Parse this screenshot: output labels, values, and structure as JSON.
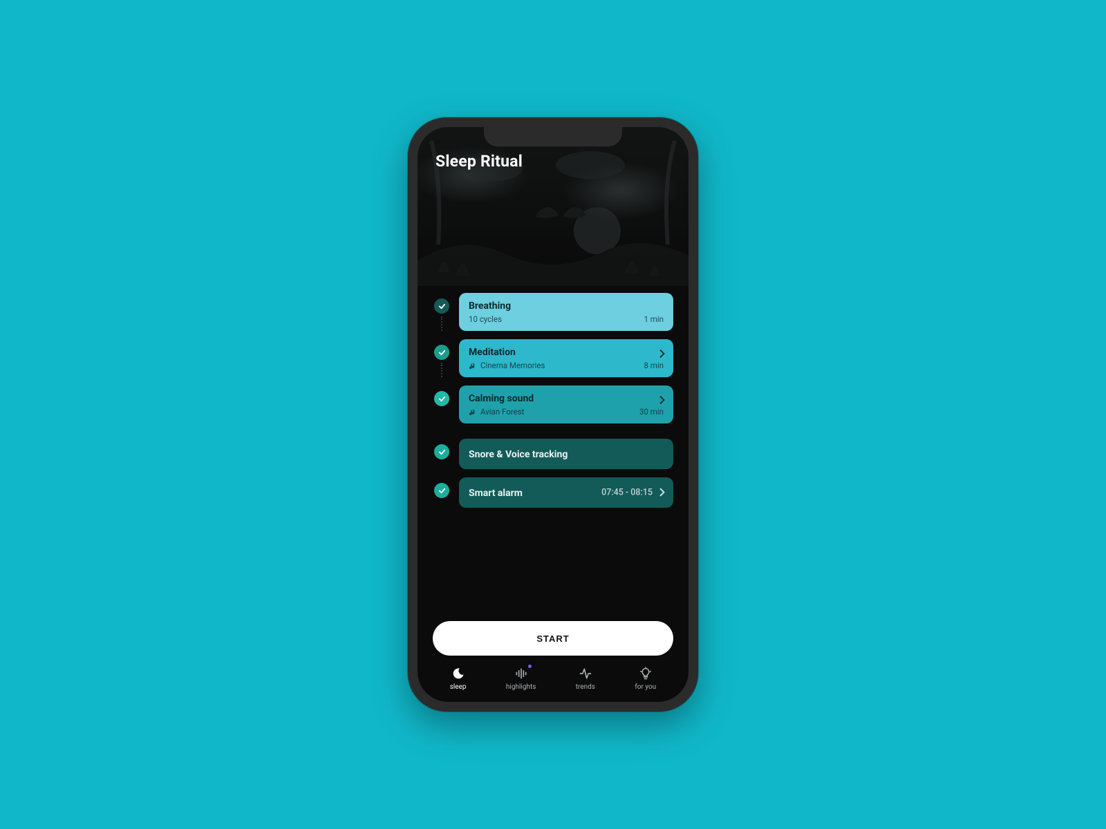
{
  "header": {
    "title": "Sleep Ritual"
  },
  "items": [
    {
      "title": "Breathing",
      "subtitle": "10 cycles",
      "duration": "1 min",
      "has_music_icon": false,
      "has_chevron": false,
      "connector_after": true
    },
    {
      "title": "Meditation",
      "subtitle": "Cinema Memories",
      "duration": "8 min",
      "has_music_icon": true,
      "has_chevron": true,
      "connector_after": true
    },
    {
      "title": "Calming sound",
      "subtitle": "Avian Forest",
      "duration": "30 min",
      "has_music_icon": true,
      "has_chevron": true,
      "connector_after": false
    },
    {
      "title": "Snore & Voice tracking",
      "right_value": "",
      "has_chevron": false
    },
    {
      "title": "Smart alarm",
      "right_value": "07:45 - 08:15",
      "has_chevron": true
    }
  ],
  "cta": {
    "label": "START"
  },
  "nav": {
    "active": "sleep",
    "items": [
      {
        "id": "sleep",
        "label": "sleep"
      },
      {
        "id": "highlights",
        "label": "highlights",
        "badge": true
      },
      {
        "id": "trends",
        "label": "trends"
      },
      {
        "id": "foryou",
        "label": "for you"
      }
    ]
  },
  "colors": {
    "page_bg": "#10b7c9",
    "screen_bg": "#0b0b0b",
    "card_tints": [
      "#6dcfe0",
      "#2db8cb",
      "#1fa1ac",
      "#135b58",
      "#135b58"
    ],
    "start_bg": "#ffffff"
  }
}
